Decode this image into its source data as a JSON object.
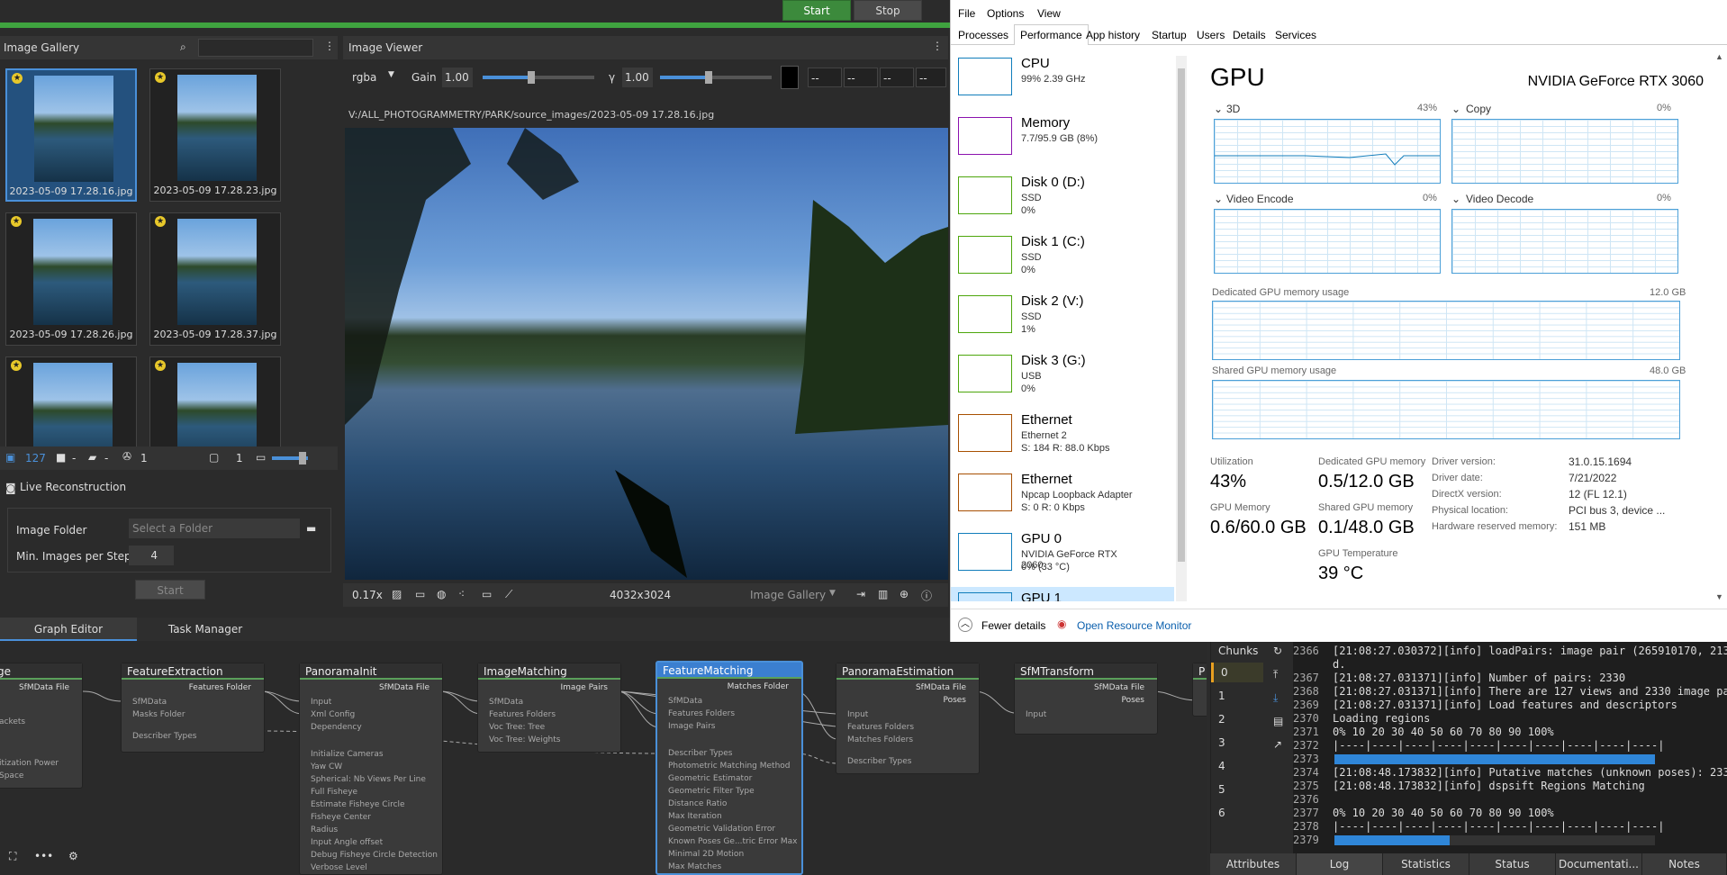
{
  "toolbar": {
    "start_label": "Start",
    "stop_label": "Stop"
  },
  "gallery": {
    "title": "Image Gallery",
    "items": [
      {
        "caption": "2023-05-09 17.28.16.jpg"
      },
      {
        "caption": "2023-05-09 17.28.23.jpg"
      },
      {
        "caption": "2023-05-09 17.28.26.jpg"
      },
      {
        "caption": "2023-05-09 17.28.37.jpg"
      },
      {
        "caption": ""
      },
      {
        "caption": ""
      }
    ],
    "footer": {
      "count": "127",
      "cam_label": "-",
      "cam2_label": "-",
      "intrinsic_count": "1",
      "count2": "1"
    }
  },
  "live": {
    "title": "Live Reconstruction",
    "folder_label": "Image Folder",
    "folder_placeholder": "Select a Folder",
    "min_label": "Min. Images per Step",
    "min_value": "4",
    "start_label": "Start"
  },
  "viewer": {
    "title": "Image Viewer",
    "channel": "rgba",
    "gain_label": "Gain",
    "gain_value": "1.00",
    "gamma_label": "γ",
    "gamma_value": "1.00",
    "rgba_placeholders": [
      "--",
      "--",
      "--",
      "--"
    ],
    "path": "V:/ALL_PHOTOGRAMMETRY/PARK/source_images/2023-05-09 17.28.16.jpg",
    "zoom": "0.17x",
    "resolution": "4032x3024",
    "source": "Image Gallery"
  },
  "graph": {
    "tabs": [
      "Graph Editor",
      "Task Manager"
    ],
    "nodes": [
      {
        "title": "ge",
        "out": "SfMData File",
        "attrs": [
          "ackets",
          "itization Power",
          "Space"
        ]
      },
      {
        "title": "FeatureExtraction",
        "out": "Features Folder",
        "attrs": [
          "SfMData",
          "Masks Folder",
          "Describer Types"
        ]
      },
      {
        "title": "PanoramaInit",
        "out": "SfMData File",
        "attrs": [
          "Input",
          "Xml Config",
          "Dependency",
          "Initialize Cameras",
          "Yaw CW",
          "Spherical: Nb Views Per Line",
          "Full Fisheye",
          "Estimate Fisheye Circle",
          "Fisheye Center",
          "Radius",
          "Input Angle offset",
          "Debug Fisheye Circle Detection",
          "Verbose Level"
        ]
      },
      {
        "title": "ImageMatching",
        "out": "Image Pairs",
        "attrs": [
          "SfMData",
          "Features Folders",
          "Voc Tree: Tree",
          "Voc Tree: Weights"
        ]
      },
      {
        "title": "FeatureMatching",
        "out": "Matches Folder",
        "attrs": [
          "SfMData",
          "Features Folders",
          "Image Pairs",
          "Describer Types",
          "Photometric Matching Method",
          "Geometric Estimator",
          "Geometric Filter Type",
          "Distance Ratio",
          "Max Iteration",
          "Geometric Validation Error",
          "Known Poses Ge...tric Error Max",
          "Minimal 2D Motion",
          "Max Matches"
        ]
      },
      {
        "title": "PanoramaEstimation",
        "out": "SfMData File",
        "out2": "Poses",
        "attrs": [
          "Input",
          "Features Folders",
          "Matches Folders",
          "Describer Types"
        ]
      },
      {
        "title": "SfMTransform",
        "out": "SfMData File",
        "out2": "Poses",
        "attrs": [
          "Input"
        ]
      },
      {
        "title": "P",
        "out": "",
        "attrs": []
      }
    ]
  },
  "chunks": {
    "title": "Chunks",
    "items": [
      "0",
      "1",
      "2",
      "3",
      "4",
      "5",
      "6"
    ]
  },
  "log": {
    "lines": [
      {
        "n": "2366",
        "t": "[21:08:27.030372][info] loadPairs: image pair (265910170, 2135397282) adde"
      },
      {
        "n": "",
        "t": "d."
      },
      {
        "n": "2367",
        "t": "[21:08:27.031371][info] Number of pairs: 2330"
      },
      {
        "n": "2368",
        "t": "[21:08:27.031371][info] There are 127 views and 2330 image pairs."
      },
      {
        "n": "2369",
        "t": "[21:08:27.031371][info] Load features and descriptors"
      },
      {
        "n": "2370",
        "t": "Loading regions"
      },
      {
        "n": "2371",
        "t": "0%   10   20   30   40   50   60   70   80   90   100%"
      },
      {
        "n": "2372",
        "t": "|----|----|----|----|----|----|----|----|----|----|"
      },
      {
        "n": "2373",
        "t": ""
      },
      {
        "n": "2374",
        "t": "[21:08:48.173832][info] Putative matches (unknown poses): 2330 image pairs."
      },
      {
        "n": "2375",
        "t": "[21:08:48.173832][info] dspsift Regions Matching"
      },
      {
        "n": "2376",
        "t": ""
      },
      {
        "n": "2377",
        "t": "0%   10   20   30   40   50   60   70   80   90   100%"
      },
      {
        "n": "2378",
        "t": "|----|----|----|----|----|----|----|----|----|----|"
      },
      {
        "n": "2379",
        "t": ""
      }
    ],
    "progress_full": 1.0,
    "progress_partial": 0.36
  },
  "bottom_tabs": [
    "Attributes",
    "Log",
    "Statistics",
    "Status",
    "Documentati...",
    "Notes"
  ],
  "taskmgr": {
    "menu": [
      "File",
      "Options",
      "View"
    ],
    "tabs": [
      "Processes",
      "Performance",
      "App history",
      "Startup",
      "Users",
      "Details",
      "Services"
    ],
    "side": [
      {
        "name": "CPU",
        "d1": "99%  2.39 GHz",
        "d2": "",
        "color": "#117dbb"
      },
      {
        "name": "Memory",
        "d1": "7.7/95.9 GB (8%)",
        "d2": "",
        "color": "#8b12ae"
      },
      {
        "name": "Disk 0 (D:)",
        "d1": "SSD",
        "d2": "0%",
        "color": "#4da60c"
      },
      {
        "name": "Disk 1 (C:)",
        "d1": "SSD",
        "d2": "0%",
        "color": "#4da60c"
      },
      {
        "name": "Disk 2 (V:)",
        "d1": "SSD",
        "d2": "1%",
        "color": "#4da60c"
      },
      {
        "name": "Disk 3 (G:)",
        "d1": "USB",
        "d2": "0%",
        "color": "#4da60c"
      },
      {
        "name": "Ethernet",
        "d1": "Ethernet 2",
        "d2": "S: 184  R: 88.0 Kbps",
        "color": "#a74f01"
      },
      {
        "name": "Ethernet",
        "d1": "Npcap Loopback Adapter",
        "d2": "S: 0  R: 0 Kbps",
        "color": "#a74f01"
      },
      {
        "name": "GPU 0",
        "d1": "NVIDIA GeForce RTX 2060",
        "d2": "0%  (33 °C)",
        "color": "#117dbb"
      },
      {
        "name": "GPU 1",
        "d1": "",
        "d2": "",
        "color": "#117dbb"
      }
    ],
    "gpu": {
      "title": "GPU",
      "model": "NVIDIA GeForce RTX 3060",
      "engines": [
        {
          "name": "3D",
          "pct": "43%"
        },
        {
          "name": "Copy",
          "pct": "0%"
        },
        {
          "name": "Video Encode",
          "pct": "0%"
        },
        {
          "name": "Video Decode",
          "pct": "0%"
        }
      ],
      "dedicated_label": "Dedicated GPU memory usage",
      "dedicated_max": "12.0 GB",
      "shared_label": "Shared GPU memory usage",
      "shared_max": "48.0 GB",
      "stats": {
        "util_label": "Utilization",
        "util": "43%",
        "ded_label": "Dedicated GPU memory",
        "ded": "0.5/12.0 GB",
        "mem_label": "GPU Memory",
        "mem": "0.6/60.0 GB",
        "shared_label": "Shared GPU memory",
        "shared": "0.1/48.0 GB",
        "temp_label": "GPU Temperature",
        "temp": "39 °C"
      },
      "info": [
        {
          "k": "Driver version:",
          "v": "31.0.15.1694"
        },
        {
          "k": "Driver date:",
          "v": "7/21/2022"
        },
        {
          "k": "DirectX version:",
          "v": "12 (FL 12.1)"
        },
        {
          "k": "Physical location:",
          "v": "PCI bus 3, device ..."
        },
        {
          "k": "Hardware reserved memory:",
          "v": "151 MB"
        }
      ]
    },
    "fewer_details": "Fewer details",
    "open_monitor": "Open Resource Monitor"
  }
}
